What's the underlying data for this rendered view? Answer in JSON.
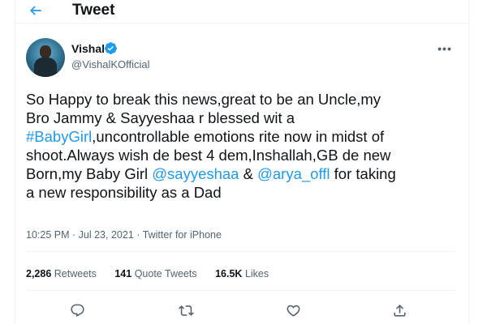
{
  "header": {
    "title": "Tweet",
    "back_icon": "arrow-left-icon"
  },
  "author": {
    "name": "Vishal",
    "handle": "@VishalKOfficial",
    "verified": true
  },
  "tweet": {
    "lines": [
      [
        {
          "t": "So Happy to break this news,great to be an Uncle,my",
          "link": false
        }
      ],
      [
        {
          "t": "Bro Jammy & Sayyeshaa r blessed wit a",
          "link": false
        }
      ],
      [
        {
          "t": "#BabyGirl",
          "link": true
        },
        {
          "t": ",uncontrollable emotions rite now in midst of",
          "link": false
        }
      ],
      [
        {
          "t": "shoot.Always wish de best 4 dem,Inshallah,GB de new",
          "link": false
        }
      ],
      [
        {
          "t": "Born,my Baby Girl ",
          "link": false
        },
        {
          "t": "@sayyeshaa",
          "link": true
        },
        {
          "t": " & ",
          "link": false
        },
        {
          "t": "@arya_offl",
          "link": true
        },
        {
          "t": " for taking",
          "link": false
        }
      ],
      [
        {
          "t": "a new responsibility as a Dad",
          "link": false
        }
      ]
    ],
    "time": "10:25 PM",
    "date": "Jul 23, 2021",
    "separator": "·",
    "source": "Twitter for iPhone"
  },
  "stats": {
    "retweets_count": "2,286",
    "retweets_label": "Retweets",
    "quotes_count": "141",
    "quotes_label": "Quote Tweets",
    "likes_count": "16.5K",
    "likes_label": "Likes"
  },
  "actions": [
    "reply-icon",
    "retweet-icon",
    "like-icon",
    "share-icon"
  ],
  "colors": {
    "text": "#0f1419",
    "secondary": "#536471",
    "accent": "#1d9bf0",
    "divider": "#eff3f4"
  }
}
